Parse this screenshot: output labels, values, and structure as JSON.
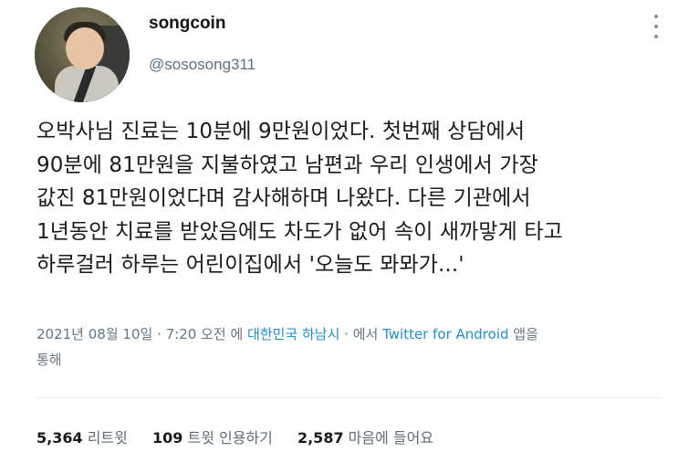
{
  "profile": {
    "name": "songcoin",
    "handle": "@sososong311"
  },
  "tweet": {
    "text": "오박사님 진료는 10분에 9만원이었다. 첫번째 상담에서\n90분에 81만원을 지불하였고 남편과 우리 인생에서 가장\n값진 81만원이었다며 감사해하며 나왔다. 다른 기관에서\n1년동안 치료를 받았음에도 차도가 없어 속이 새까맣게 타고\n하루걸러 하루는 어린이집에서 '오늘도 뫄뫄가...'"
  },
  "meta": {
    "date": "2021년 08월 10일",
    "separator": " · ",
    "time": "7:20 오전",
    "location_prefix": " 에 ",
    "location": "대한민국 하남시",
    "via_prefix": " · 에서 ",
    "source": "Twitter for Android",
    "via_suffix": " 앱을\n통해"
  },
  "stats": {
    "retweets_count": "5,364",
    "retweets_label": "리트윗",
    "quotes_count": "109",
    "quotes_label": "트윗 인용하기",
    "likes_count": "2,587",
    "likes_label": "마음에 들어요"
  },
  "colors": {
    "link": "#1d8fd8",
    "secondary_text": "#5b7083"
  },
  "icons": {
    "more": "vertical-ellipsis"
  }
}
